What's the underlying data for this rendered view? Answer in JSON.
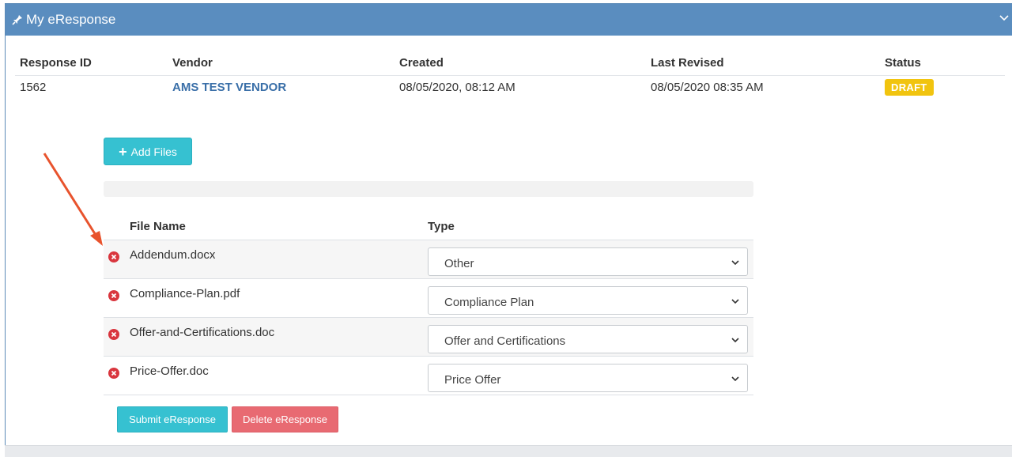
{
  "panel": {
    "title": "My eResponse",
    "header_color": "#5a8dbf"
  },
  "summary": {
    "headers": [
      "Response ID",
      "Vendor",
      "Created",
      "Last Revised",
      "Status"
    ],
    "row": {
      "response_id": "1562",
      "vendor": "AMS TEST VENDOR",
      "created": "08/05/2020, 08:12 AM",
      "last_revised": "08/05/2020 08:35 AM",
      "status": "DRAFT"
    }
  },
  "upload": {
    "add_files_label": "Add Files"
  },
  "files": {
    "headers": [
      "File Name",
      "Type"
    ],
    "rows": [
      {
        "name": "Addendum.docx",
        "type": "Other"
      },
      {
        "name": "Compliance-Plan.pdf",
        "type": "Compliance Plan"
      },
      {
        "name": "Offer-and-Certifications.doc",
        "type": "Offer and Certifications"
      },
      {
        "name": "Price-Offer.doc",
        "type": "Price Offer"
      }
    ]
  },
  "actions": {
    "submit_label": "Submit eResponse",
    "delete_label": "Delete eResponse"
  },
  "colors": {
    "accent": "#36c1d1",
    "danger": "#e86a72",
    "status_draft": "#f1c40f",
    "annotation_arrow": "#e8532d"
  }
}
